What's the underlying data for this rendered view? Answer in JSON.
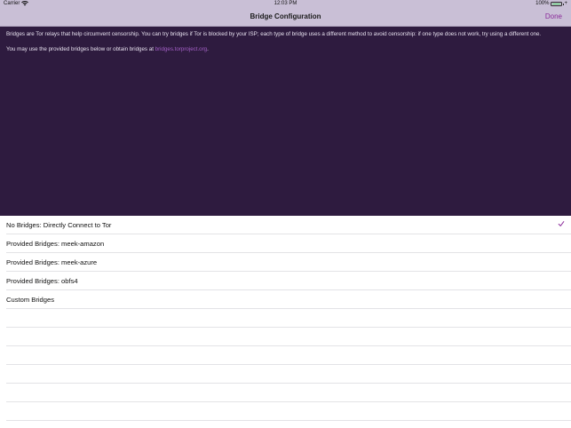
{
  "status_bar": {
    "carrier": "Carrier",
    "time": "12:03 PM",
    "battery": "100%"
  },
  "nav": {
    "title": "Bridge Configuration",
    "done_label": "Done"
  },
  "info": {
    "paragraph1": "Bridges are Tor relays that help circumvent censorship. You can try bridges if Tor is blocked by your ISP; each type of bridge uses a different method to avoid censorship: if one type does not work, try using a different one.",
    "paragraph2_prefix": "You may use the provided bridges below or obtain bridges at ",
    "link": "bridges.torproject.org",
    "paragraph2_suffix": "."
  },
  "options": [
    {
      "label": "No Bridges: Directly Connect to Tor",
      "selected": true
    },
    {
      "label": "Provided Bridges: meek-amazon",
      "selected": false
    },
    {
      "label": "Provided Bridges: meek-azure",
      "selected": false
    },
    {
      "label": "Provided Bridges: obfs4",
      "selected": false
    },
    {
      "label": "Custom Bridges",
      "selected": false
    }
  ],
  "colors": {
    "nav_background": "#c9bfd6",
    "panel_background": "#2e1b3f",
    "accent": "#8a2a9a",
    "link": "#a35fc6"
  }
}
